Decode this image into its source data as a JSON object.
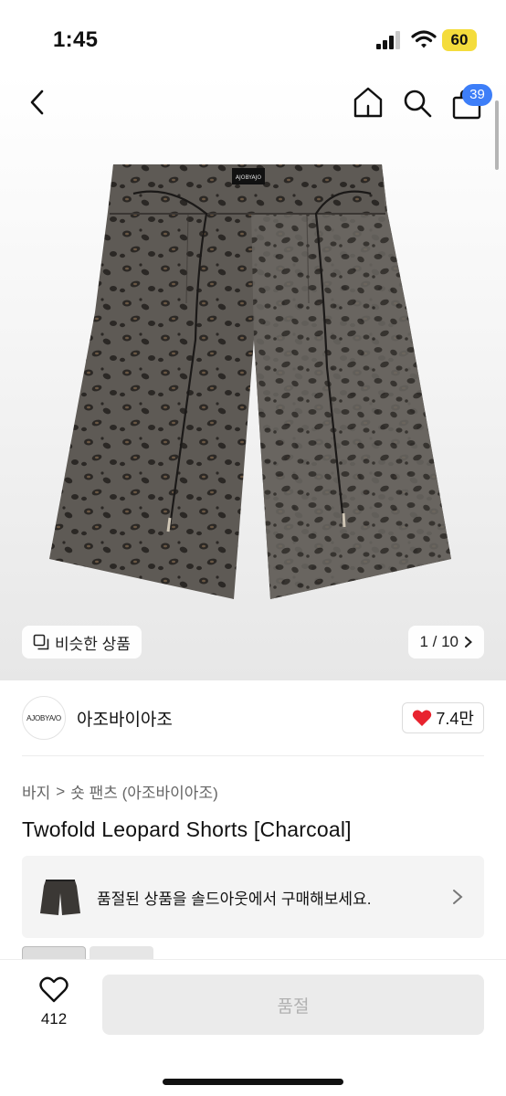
{
  "status": {
    "time": "1:45",
    "battery": "60",
    "icons": [
      "cellular-signal-icon",
      "wifi-icon",
      "battery-icon"
    ]
  },
  "header": {
    "cart_count": "39",
    "icons": [
      "back-chevron-icon",
      "home-icon",
      "search-icon",
      "shopping-bag-icon"
    ]
  },
  "gallery": {
    "similar_label": "비슷한 상품",
    "pager": "1 / 10",
    "waistband_label": "AJOBYAJO"
  },
  "brand": {
    "logo_text": "AJOBYA/O",
    "name": "아조바이아조",
    "likes": "7.4만"
  },
  "breadcrumb": {
    "category": "바지",
    "separator": ">",
    "subcategory": "숏 팬츠 (아조바이아조)"
  },
  "product": {
    "title": "Twofold Leopard Shorts [Charcoal]"
  },
  "soldout_card": {
    "text": "품절된 상품을 솔드아웃에서 구매해보세요."
  },
  "bottom_bar": {
    "wish_count": "412",
    "action_label": "품절"
  },
  "colors": {
    "accent_badge": "#3d7ef8",
    "battery": "#f4dc3c",
    "heart": "#e8232f",
    "disabled_button": "#ebebeb"
  }
}
